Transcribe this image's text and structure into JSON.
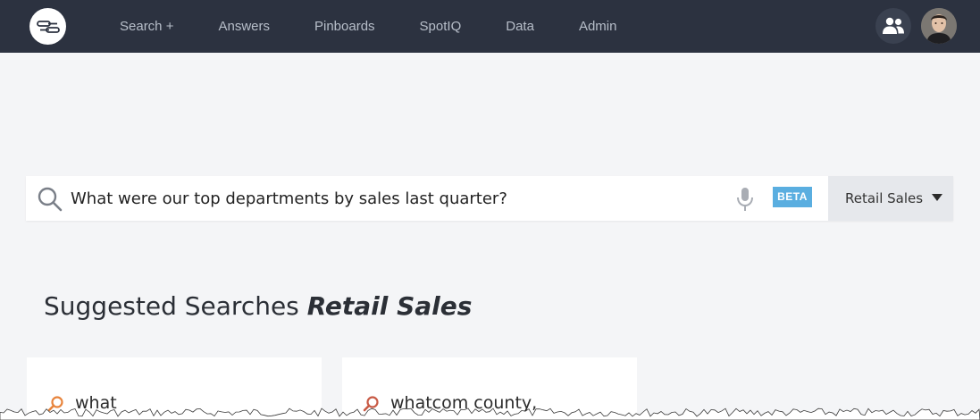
{
  "nav": {
    "items": [
      {
        "label": "Search +"
      },
      {
        "label": "Answers"
      },
      {
        "label": "Pinboards"
      },
      {
        "label": "SpotIQ"
      },
      {
        "label": "Data"
      },
      {
        "label": "Admin"
      }
    ]
  },
  "search": {
    "value": "What were our top departments by sales last quarter?",
    "beta_label": "BETA",
    "source_label": "Retail Sales"
  },
  "suggested": {
    "heading": "Suggested Searches",
    "source": "Retail Sales",
    "cards": [
      {
        "text": "what"
      },
      {
        "text": "whatcom county,"
      }
    ]
  },
  "colors": {
    "topbar": "#2c3240",
    "nav_text": "#b7bec9",
    "accent_orange": "#e8843c",
    "beta": "#5aaee0",
    "background": "#f4f5f7"
  }
}
